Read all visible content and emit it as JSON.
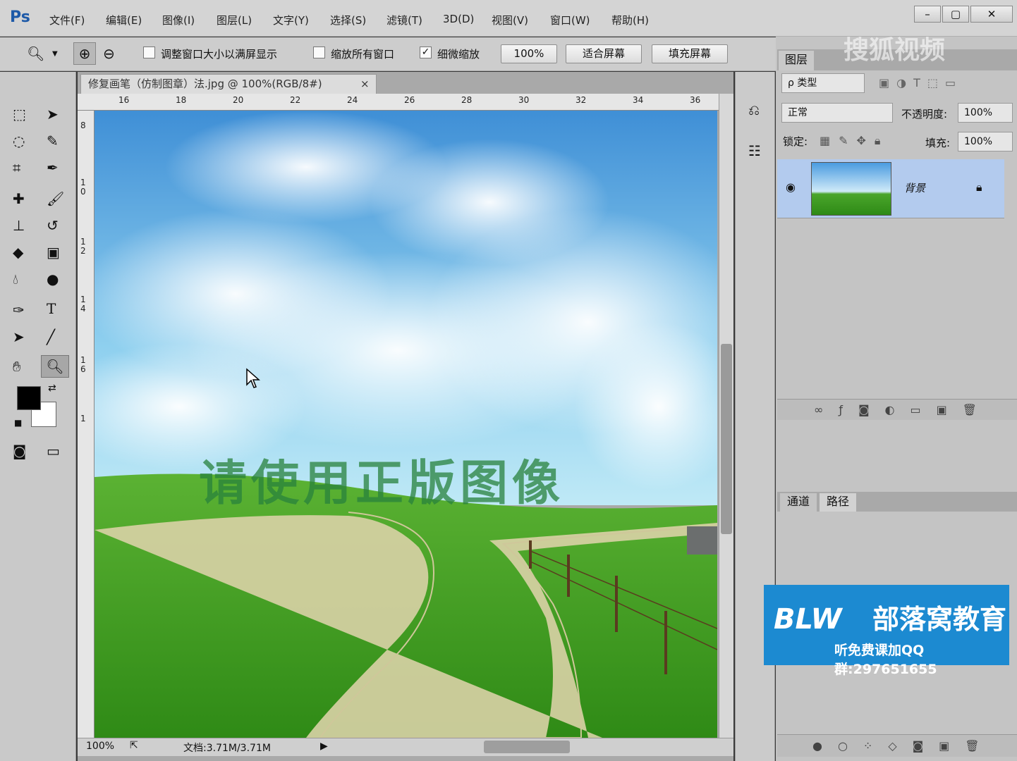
{
  "app": {
    "logo": "Ps"
  },
  "menu": [
    "文件(F)",
    "编辑(E)",
    "图像(I)",
    "图层(L)",
    "文字(Y)",
    "选择(S)",
    "滤镜(T)",
    "3D(D)",
    "视图(V)",
    "窗口(W)",
    "帮助(H)"
  ],
  "window_controls": {
    "minimize": "–",
    "maximize": "▢",
    "close": "✕"
  },
  "options": {
    "chk1_label": "调整窗口大小以满屏显示",
    "chk1_checked": "",
    "chk2_label": "缩放所有窗口",
    "chk2_checked": "",
    "chk3_label": "细微缩放",
    "chk3_checked": "✓",
    "zoom_btn": "100%",
    "fit_btn": "适合屏幕",
    "fill_btn": "填充屏幕"
  },
  "document": {
    "tab_title": "修复画笔（仿制图章）法.jpg @ 100%(RGB/8#)",
    "tab_close": "×",
    "zoom": "100%",
    "doc_info": "文档:3.71M/3.71M"
  },
  "ruler_h": [
    "16",
    "18",
    "20",
    "22",
    "24",
    "26",
    "28",
    "30",
    "32",
    "34",
    "36"
  ],
  "ruler_v": [
    "8",
    "10",
    "12",
    "14",
    "16",
    "1"
  ],
  "canvas": {
    "watermark": "请使用正版图像",
    "sky_color": "#5aa6dc",
    "grass_color": "#3e9a22"
  },
  "layers_panel": {
    "tab": "图层",
    "filter_label": "ρ 类型",
    "blend_mode": "正常",
    "opacity_label": "不透明度:",
    "opacity": "100%",
    "lock_label": "锁定:",
    "fill_label": "填充:",
    "fill": "100%",
    "layer_name": "背景"
  },
  "channels_panel": {
    "tabs": [
      "通道",
      "路径"
    ]
  },
  "overlay": {
    "sohu": "搜狐视频",
    "blw_logo": "BLW",
    "blw_title": "部落窝教育",
    "blw_sub": "听免费课加QQ群:297651655"
  }
}
